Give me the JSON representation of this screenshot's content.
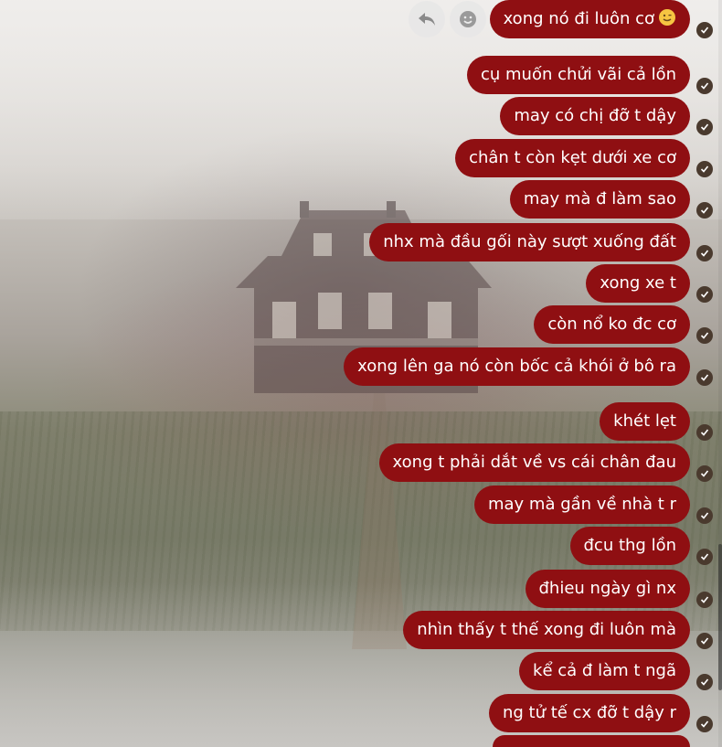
{
  "toolbar": {
    "reply_icon": "reply-icon",
    "react_icon": "smiley-icon"
  },
  "messages": [
    {
      "text": "xong nó đi luôn cơ",
      "emoji": "smile-emoji",
      "status": "seen"
    },
    {
      "text": "cụ muốn chửi vãi cả lồn",
      "status": "seen"
    },
    {
      "text": "may có chị đỡ t dậy",
      "status": "seen"
    },
    {
      "text": "chân t còn kẹt dưới xe cơ",
      "status": "seen"
    },
    {
      "text": "may mà đ làm sao",
      "status": "seen"
    },
    {
      "text": "nhx mà đầu gối này sượt xuống đất",
      "status": "seen"
    },
    {
      "text": "xong xe t",
      "status": "seen"
    },
    {
      "text": "còn nổ ko đc cơ",
      "status": "seen"
    },
    {
      "text": "xong lên ga nó còn bốc cả khói ở bô ra",
      "status": "seen"
    },
    {
      "text": "khét lẹt",
      "status": "seen"
    },
    {
      "text": "xong t phải dắt về vs cái chân đau",
      "status": "seen"
    },
    {
      "text": "may mà gần về nhà t r",
      "status": "seen"
    },
    {
      "text": "đcu thg lồn",
      "status": "seen"
    },
    {
      "text": "đhieu ngày gì nx",
      "status": "seen"
    },
    {
      "text": "nhìn thấy t thế xong đi luôn mà",
      "status": "seen"
    },
    {
      "text": "kể cả đ làm t ngã",
      "status": "seen"
    },
    {
      "text": "ng tử tế cx đỡ t dậy r",
      "status": "seen"
    }
  ],
  "colors": {
    "bubble": "#8f0f12",
    "bubble_text": "#ffffff",
    "tick": "#4a3a2e"
  }
}
